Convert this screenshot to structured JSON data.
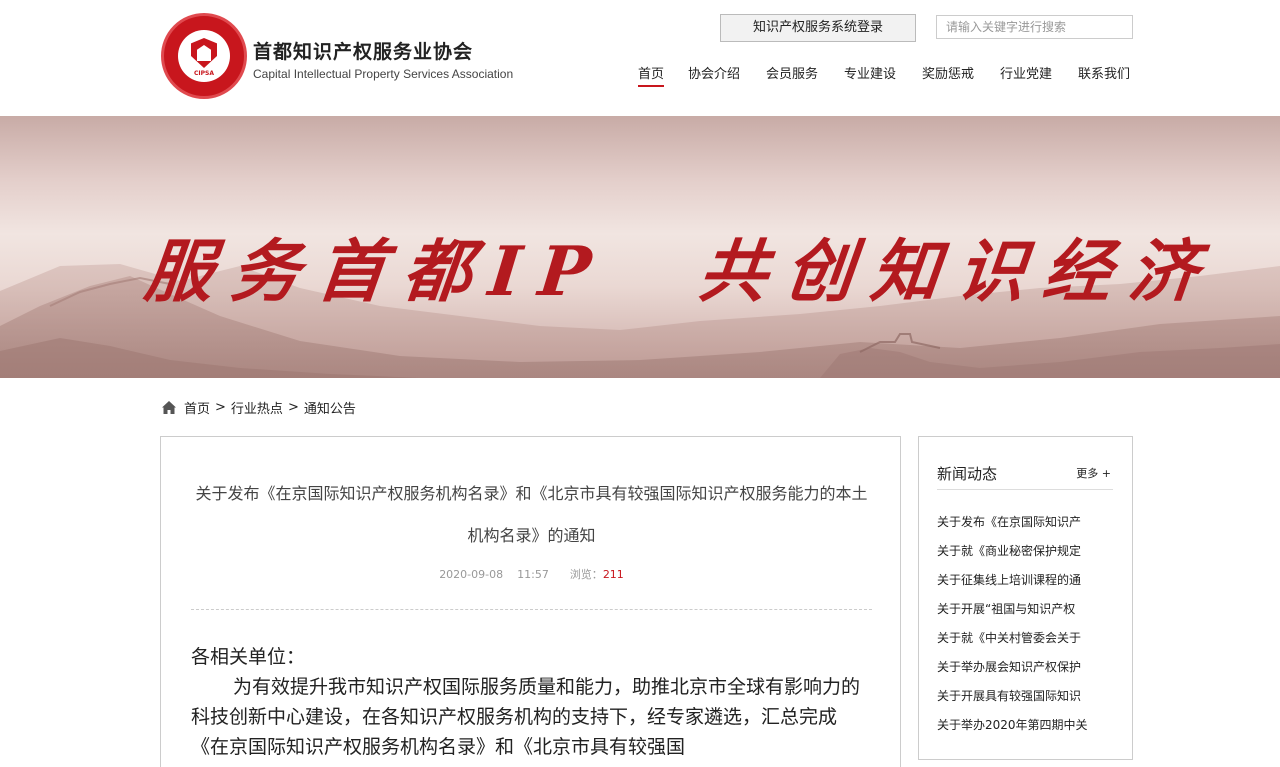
{
  "header": {
    "org_name_cn": "首都知识产权服务业协会",
    "org_name_en": "Capital Intellectual Property Services Association",
    "logo_abbr": "CIPSA",
    "login_button": "知识产权服务系统登录",
    "search_placeholder": "请输入关键字进行搜索"
  },
  "nav": {
    "items": [
      {
        "label": "首页",
        "active": true
      },
      {
        "label": "协会介绍"
      },
      {
        "label": "会员服务"
      },
      {
        "label": "专业建设"
      },
      {
        "label": "奖励惩戒"
      },
      {
        "label": "行业党建"
      },
      {
        "label": "联系我们"
      }
    ]
  },
  "banner": {
    "slogan_left": "服务首都IP",
    "slogan_right": "共创知识经济"
  },
  "breadcrumb": {
    "items": [
      "首页",
      "行业热点",
      "通知公告"
    ],
    "separator": ">"
  },
  "article": {
    "title": "关于发布《在京国际知识产权服务机构名录》和《北京市具有较强国际知识产权服务能力的本土机构名录》的通知",
    "date": "2020-09-08",
    "time": "11:57",
    "views_label": "浏览：",
    "views": "211",
    "greeting": "各相关单位：",
    "body_paragraph": "为有效提升我市知识产权国际服务质量和能力，助推北京市全球有影响力的科技创新中心建设，在各知识产权服务机构的支持下，经专家遴选，汇总完成《在京国际知识产权服务机构名录》和《北京市具有较强国"
  },
  "sidebar": {
    "title": "新闻动态",
    "more": "更多 +",
    "items": [
      "关于发布《在京国际知识产",
      "关于就《商业秘密保护规定",
      "关于征集线上培训课程的通",
      "关于开展“祖国与知识产权",
      "关于就《中关村管委会关于",
      "关于举办展会知识产权保护",
      "关于开展具有较强国际知识",
      "关于举办2020年第四期中关"
    ]
  },
  "colors": {
    "brand_red": "#c8161d",
    "banner_tone": "#e4cfcb"
  }
}
